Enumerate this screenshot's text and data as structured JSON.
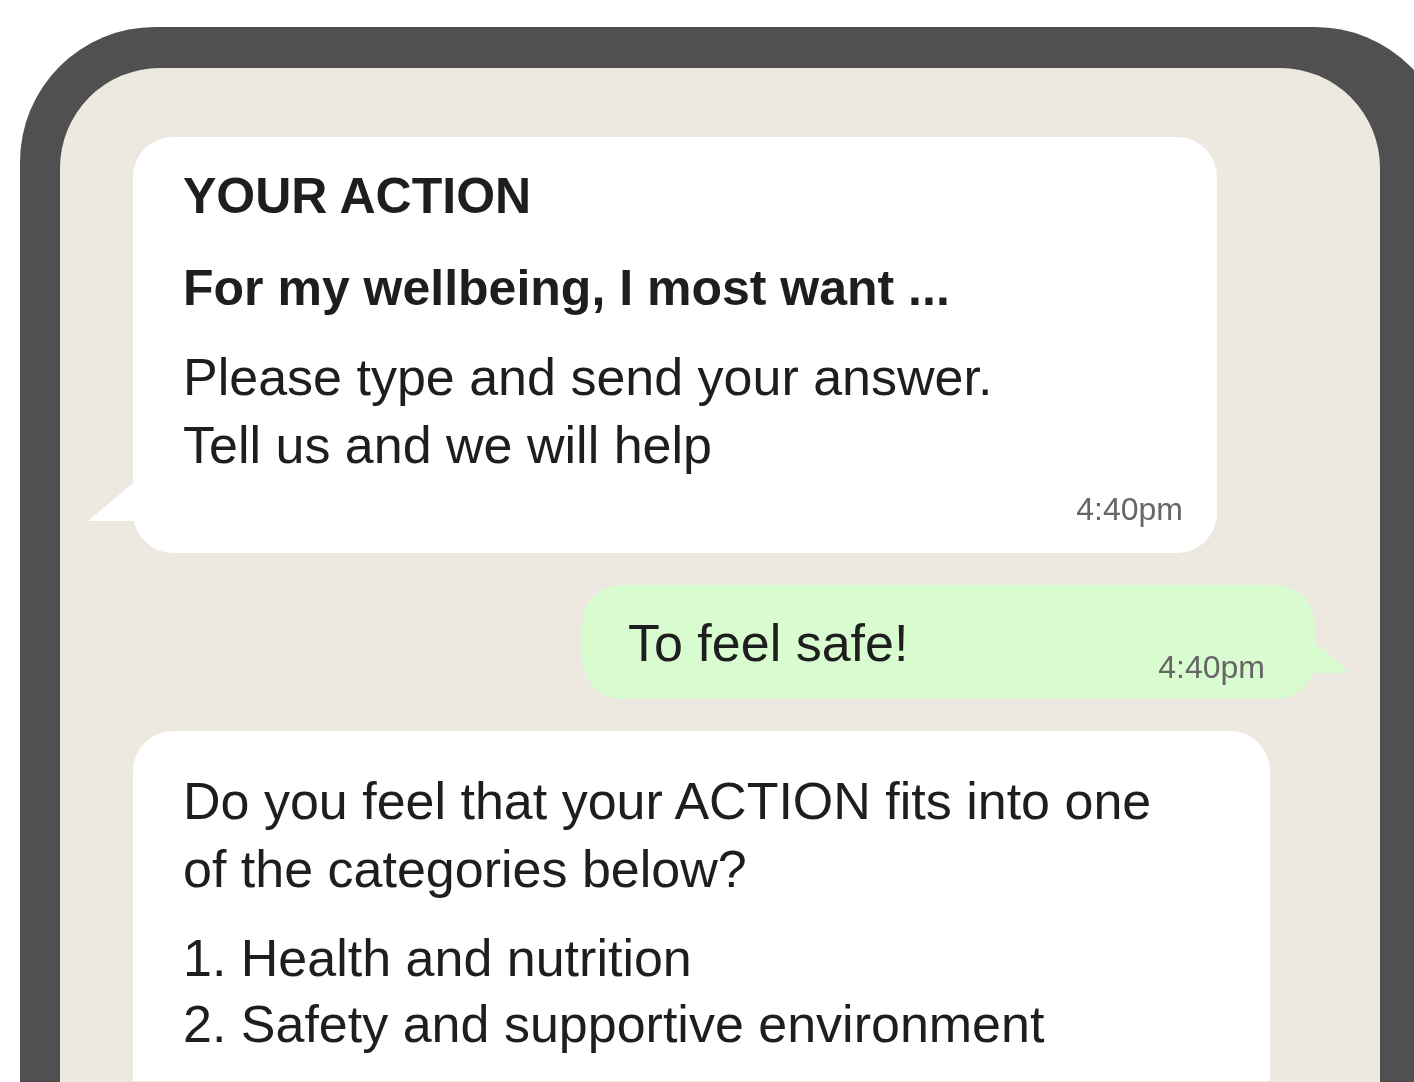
{
  "messages": [
    {
      "kind": "incoming",
      "title": "YOUR ACTION",
      "heading": "For my wellbeing, I most want ...",
      "text": "Please type and send your answer.\nTell us and we will help",
      "time": "4:40pm"
    },
    {
      "kind": "outgoing",
      "text": "To feel safe!",
      "time": "4:40pm"
    },
    {
      "kind": "incoming",
      "text": "Do you feel that your ACTION fits into one of the categories below?",
      "list": [
        "1. Health and nutrition",
        "2. Safety and supportive environment"
      ]
    }
  ]
}
